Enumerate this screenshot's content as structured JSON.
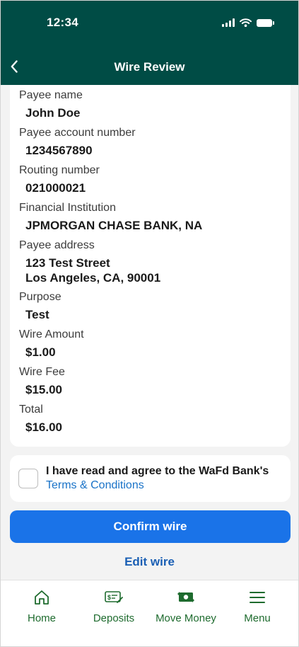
{
  "status_bar": {
    "time": "12:34"
  },
  "header": {
    "title": "Wire Review"
  },
  "review": {
    "fields": [
      {
        "label": "Payee name",
        "value": "John Doe"
      },
      {
        "label": "Payee account number",
        "value": "1234567890"
      },
      {
        "label": "Routing number",
        "value": "021000021"
      },
      {
        "label": "Financial Institution",
        "value": "JPMORGAN CHASE BANK, NA"
      },
      {
        "label": "Payee address",
        "value_line1": "123 Test Street",
        "value_line2": "Los Angeles, CA, 90001"
      },
      {
        "label": "Purpose",
        "value": "Test"
      },
      {
        "label": "Wire Amount",
        "value": "$1.00"
      },
      {
        "label": "Wire Fee",
        "value": "$15.00"
      },
      {
        "label": "Total",
        "value": "$16.00"
      }
    ]
  },
  "terms": {
    "text": "I have read and agree to the WaFd Bank's",
    "link": "Terms & Conditions",
    "checked": false
  },
  "actions": {
    "confirm": "Confirm wire",
    "edit": "Edit wire"
  },
  "tabbar": {
    "items": [
      {
        "label": "Home",
        "icon": "home-icon"
      },
      {
        "label": "Deposits",
        "icon": "deposit-check-icon"
      },
      {
        "label": "Move Money",
        "icon": "money-transfer-icon"
      },
      {
        "label": "Menu",
        "icon": "menu-icon"
      }
    ]
  },
  "colors": {
    "header_bg": "#004c45",
    "primary_button": "#1a73e8",
    "tab_green": "#1e6b2e",
    "link_blue": "#1a73c8"
  }
}
